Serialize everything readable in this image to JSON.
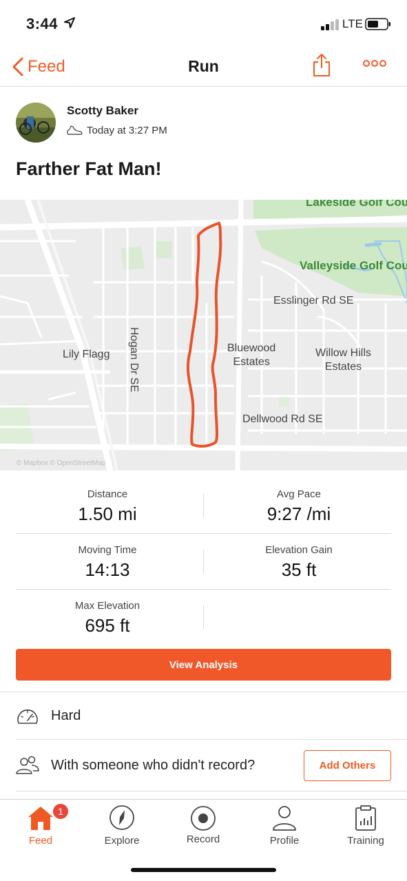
{
  "status_bar": {
    "time": "3:44",
    "network": "LTE"
  },
  "nav": {
    "back_label": "Feed",
    "title": "Run"
  },
  "author": {
    "name": "Scotty Baker",
    "timestamp": "Today at 3:27 PM"
  },
  "activity": {
    "title": "Farther Fat Man!"
  },
  "map": {
    "labels": {
      "lakeside": "Lakeside Golf Cou",
      "valleyside": "Valleyside Golf Cou",
      "esslinger": "Esslinger Rd SE",
      "hogan": "Hogan Dr SE",
      "lily": "Lily Flagg",
      "bluewood": "Bluewood\nEstates",
      "willow": "Willow Hills\nEstates",
      "dellwood": "Dellwood Rd SE",
      "attribution": "© Mapbox © OpenStreetMap"
    },
    "route_color": "#e8542a"
  },
  "stats": {
    "distance": {
      "label": "Distance",
      "value": "1.50 mi"
    },
    "avg_pace": {
      "label": "Avg Pace",
      "value": "9:27 /mi"
    },
    "moving_time": {
      "label": "Moving Time",
      "value": "14:13"
    },
    "elevation_gain": {
      "label": "Elevation Gain",
      "value": "35 ft"
    },
    "max_elevation": {
      "label": "Max Elevation",
      "value": "695 ft"
    }
  },
  "actions": {
    "view_analysis": "View Analysis",
    "perceived_exertion": "Hard",
    "with_someone": "With someone who didn't record?",
    "add_others": "Add Others"
  },
  "tabs": [
    {
      "label": "Feed",
      "icon": "home-icon",
      "badge": "1",
      "active": true
    },
    {
      "label": "Explore",
      "icon": "compass-icon"
    },
    {
      "label": "Record",
      "icon": "record-icon"
    },
    {
      "label": "Profile",
      "icon": "person-icon"
    },
    {
      "label": "Training",
      "icon": "training-chart-icon"
    }
  ],
  "colors": {
    "accent": "#f05a22",
    "badge": "#e8463a",
    "map_park": "#cfe8c6"
  }
}
